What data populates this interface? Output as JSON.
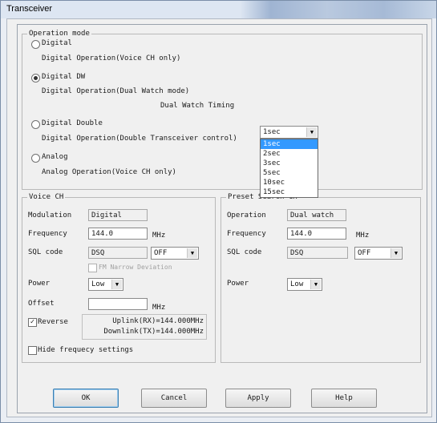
{
  "window": {
    "title": "Transceiver"
  },
  "operation_mode": {
    "legend": "Operation mode",
    "options": [
      {
        "label": "Digital",
        "desc": "Digital Operation(Voice CH only)"
      },
      {
        "label": "Digital DW",
        "desc": "Digital Operation(Dual Watch mode)"
      },
      {
        "label": "Digital Double",
        "desc": "Digital Operation(Double Transceiver control)"
      },
      {
        "label": "Analog",
        "desc": "Analog Operation(Voice CH only)"
      }
    ],
    "selected_index": 1,
    "dw_timing_label": "Dual Watch Timing",
    "dw_timing_value": "1sec",
    "dw_timing_options": [
      "1sec",
      "2sec",
      "3sec",
      "5sec",
      "10sec",
      "15sec"
    ],
    "dw_timing_highlighted": "1sec"
  },
  "voice_ch": {
    "legend": "Voice CH",
    "modulation_label": "Modulation",
    "modulation_value": "Digital",
    "frequency_label": "Frequency",
    "frequency_value": "144.0",
    "frequency_unit": "MHz",
    "sql_label": "SQL code",
    "sql_value": "DSQ",
    "sql_option": "OFF",
    "fm_narrow_label": "FM Narrow Deviation",
    "power_label": "Power",
    "power_value": "Low",
    "offset_label": "Offset",
    "offset_value": "",
    "offset_unit": "MHz",
    "reverse_label": "Reverse",
    "reverse_checked": true,
    "uplink_text": "Uplink(RX)=144.000MHz",
    "downlink_text": "Downlink(TX)=144.000MHz",
    "hide_freq_label": "Hide frequecy settings"
  },
  "preset_search": {
    "legend": "Preset Search CH",
    "operation_label": "Operation",
    "operation_value": "Dual watch",
    "frequency_label": "Frequency",
    "frequency_value": "144.0",
    "frequency_unit": "MHz",
    "sql_label": "SQL code",
    "sql_value": "DSQ",
    "sql_option": "OFF",
    "power_label": "Power",
    "power_value": "Low"
  },
  "buttons": {
    "ok": "OK",
    "cancel": "Cancel",
    "apply": "Apply",
    "help": "Help"
  }
}
